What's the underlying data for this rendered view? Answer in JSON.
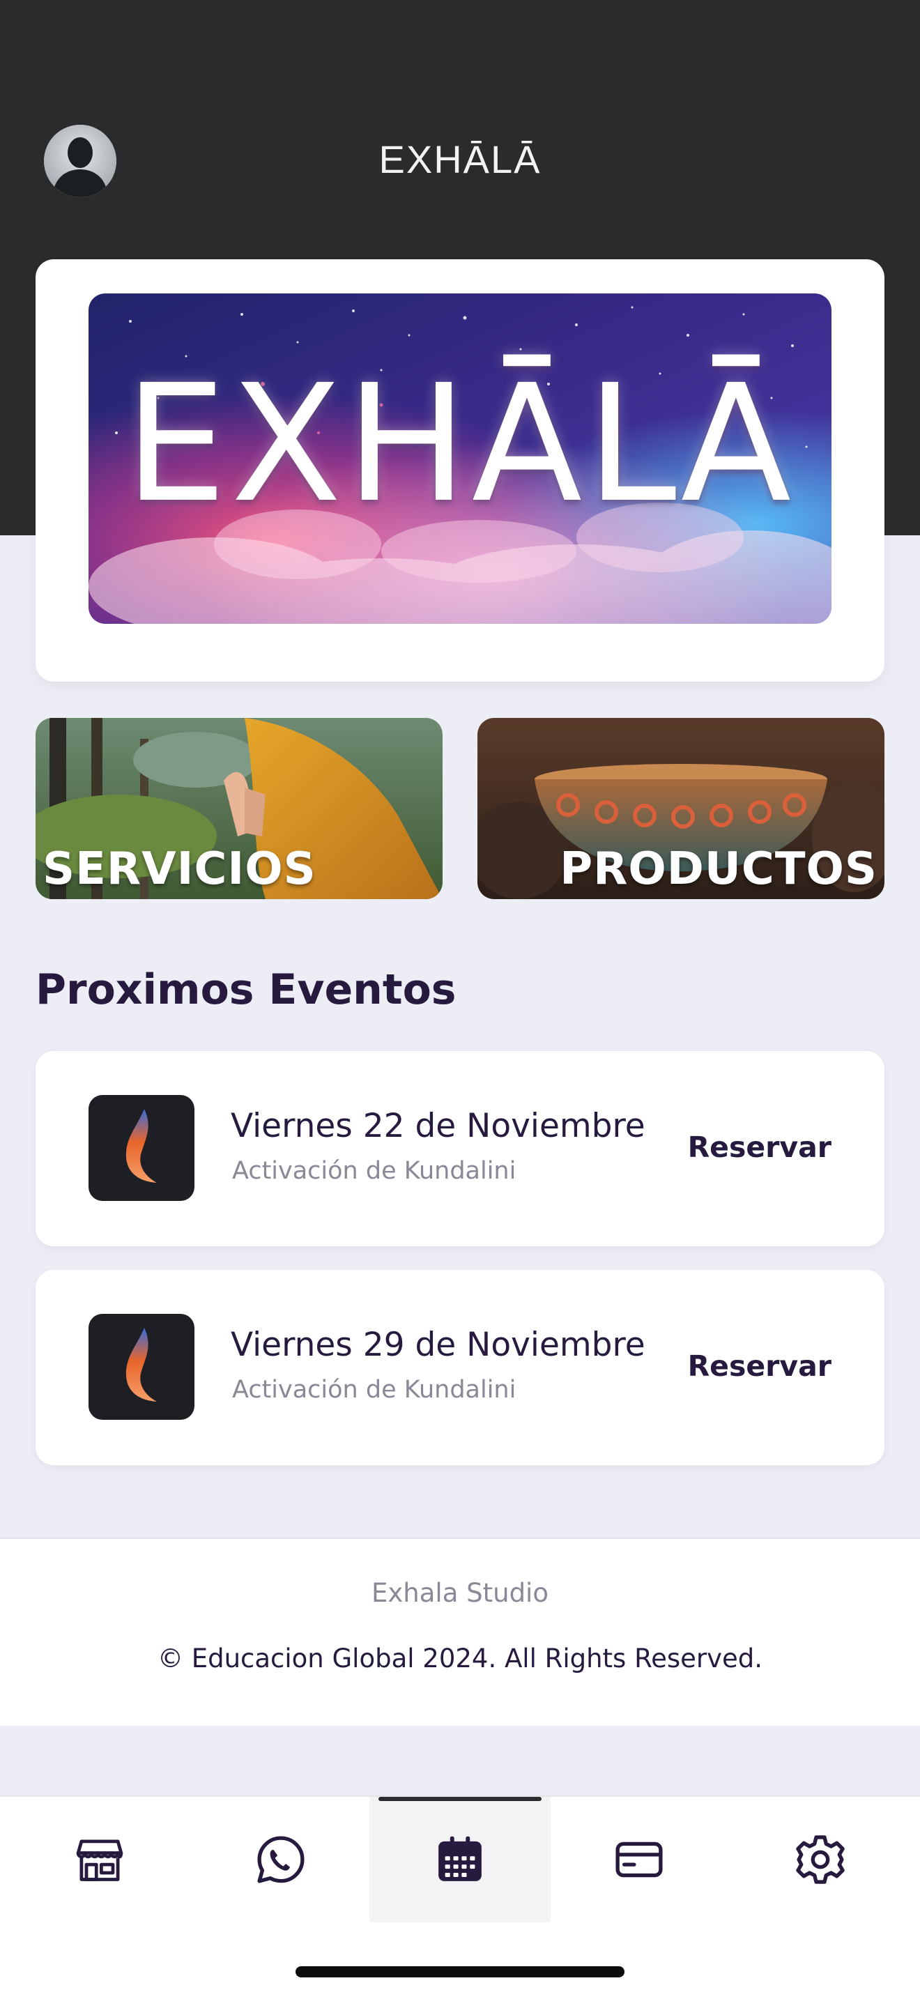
{
  "header": {
    "app_title": "EXHĀLĀ",
    "avatar_icon": "user-avatar-icon"
  },
  "hero": {
    "banner_text": "EXHĀLĀ"
  },
  "tiles": [
    {
      "label": "SERVICIOS"
    },
    {
      "label": "PRODUCTOS"
    }
  ],
  "events_section": {
    "title": "Proximos Eventos",
    "items": [
      {
        "date": "Viernes 22 de Noviembre",
        "subtitle": "Activación de Kundalini",
        "action": "Reservar"
      },
      {
        "date": "Viernes 29 de Noviembre",
        "subtitle": "Activación de Kundalini",
        "action": "Reservar"
      }
    ]
  },
  "footer": {
    "studio": "Exhala Studio",
    "copyright": "© Educacion Global 2024. All Rights Reserved."
  },
  "tabbar": {
    "items": [
      {
        "icon": "store-icon",
        "active": false
      },
      {
        "icon": "whatsapp-icon",
        "active": false
      },
      {
        "icon": "calendar-icon",
        "active": true
      },
      {
        "icon": "credit-card-icon",
        "active": false
      },
      {
        "icon": "gear-icon",
        "active": false
      }
    ]
  },
  "colors": {
    "header_bg": "#2b2b2d",
    "page_bg": "#ecedf5",
    "text_primary": "#261a3f",
    "text_muted": "#8c8796"
  }
}
